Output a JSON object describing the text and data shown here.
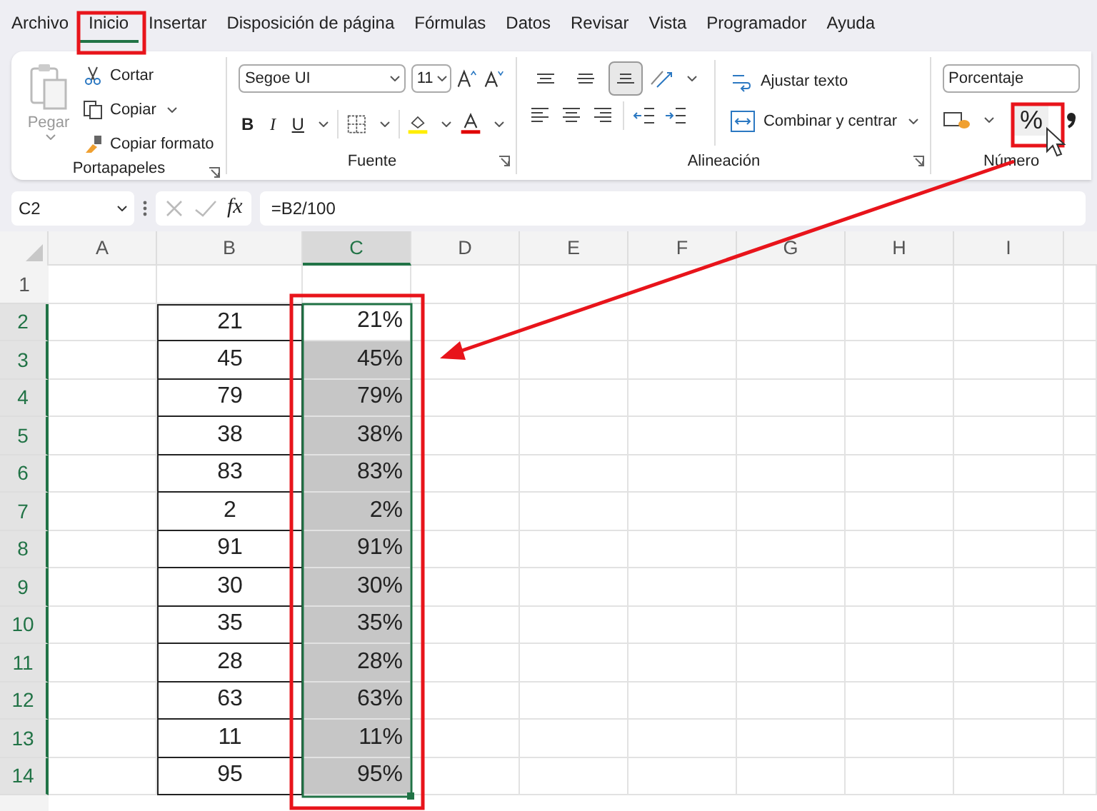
{
  "menu_tabs": [
    {
      "label": "Archivo",
      "selected": false
    },
    {
      "label": "Inicio",
      "selected": true
    },
    {
      "label": "Insertar",
      "selected": false
    },
    {
      "label": "Disposición de página",
      "selected": false
    },
    {
      "label": "Fórmulas",
      "selected": false
    },
    {
      "label": "Datos",
      "selected": false
    },
    {
      "label": "Revisar",
      "selected": false
    },
    {
      "label": "Vista",
      "selected": false
    },
    {
      "label": "Programador",
      "selected": false
    },
    {
      "label": "Ayuda",
      "selected": false
    }
  ],
  "clipboard": {
    "paste": "Pegar",
    "paste_disabled": true,
    "cut": "Cortar",
    "copy": "Copiar",
    "format_painter": "Copiar formato",
    "label": "Portapapeles"
  },
  "font": {
    "family": "Segoe UI",
    "size": "11",
    "bold": "B",
    "italic": "I",
    "underline": "U",
    "label": "Fuente"
  },
  "alignment": {
    "vertical": [
      {
        "kind": "top",
        "selected": false
      },
      {
        "kind": "middle",
        "selected": false
      },
      {
        "kind": "bottom",
        "selected": true
      }
    ],
    "wrap": "Ajustar texto",
    "merge": "Combinar y centrar",
    "label": "Alineación"
  },
  "number": {
    "format": "Porcentaje",
    "percent": "%",
    "label": "Número"
  },
  "formula_bar": {
    "name_box": "C2",
    "fx": "fx",
    "formula": "=B2/100"
  },
  "sheet": {
    "columns": [
      {
        "label": "A",
        "selected": false
      },
      {
        "label": "B",
        "selected": false
      },
      {
        "label": "C",
        "selected": true
      },
      {
        "label": "D",
        "selected": false
      },
      {
        "label": "E",
        "selected": false
      },
      {
        "label": "F",
        "selected": false
      },
      {
        "label": "G",
        "selected": false
      },
      {
        "label": "H",
        "selected": false
      },
      {
        "label": "I",
        "selected": false
      }
    ],
    "rows": [
      {
        "header": "1",
        "selected": false
      },
      {
        "header": "2",
        "selected": true,
        "b": "21",
        "c": "21%",
        "c_shaded": false
      },
      {
        "header": "3",
        "selected": true,
        "b": "45",
        "c": "45%",
        "c_shaded": true
      },
      {
        "header": "4",
        "selected": true,
        "b": "79",
        "c": "79%",
        "c_shaded": true
      },
      {
        "header": "5",
        "selected": true,
        "b": "38",
        "c": "38%",
        "c_shaded": true
      },
      {
        "header": "6",
        "selected": true,
        "b": "83",
        "c": "83%",
        "c_shaded": true
      },
      {
        "header": "7",
        "selected": true,
        "b": "2",
        "c": "2%",
        "c_shaded": true
      },
      {
        "header": "8",
        "selected": true,
        "b": "91",
        "c": "91%",
        "c_shaded": true
      },
      {
        "header": "9",
        "selected": true,
        "b": "30",
        "c": "30%",
        "c_shaded": true
      },
      {
        "header": "10",
        "selected": true,
        "b": "35",
        "c": "35%",
        "c_shaded": true
      },
      {
        "header": "11",
        "selected": true,
        "b": "28",
        "c": "28%",
        "c_shaded": true
      },
      {
        "header": "12",
        "selected": true,
        "b": "63",
        "c": "63%",
        "c_shaded": true
      },
      {
        "header": "13",
        "selected": true,
        "b": "11",
        "c": "11%",
        "c_shaded": true
      },
      {
        "header": "14",
        "selected": true,
        "b": "95",
        "c": "95%",
        "c_shaded": true
      }
    ]
  }
}
